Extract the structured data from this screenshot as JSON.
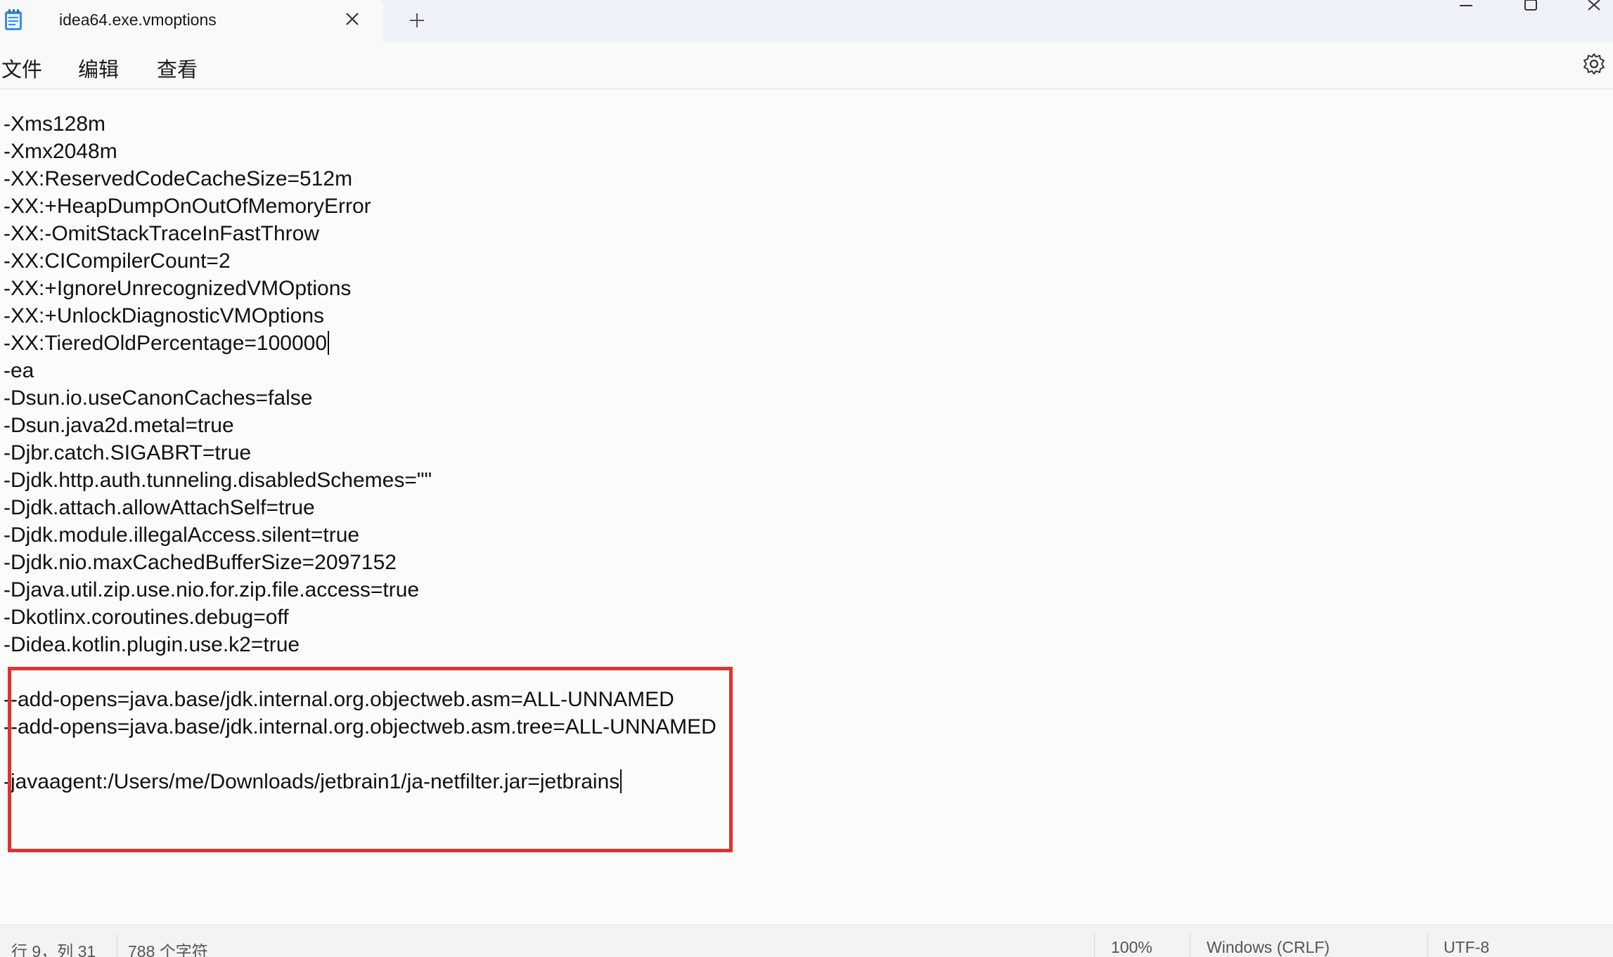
{
  "window": {
    "tab_title": "idea64.exe.vmoptions",
    "icons": {
      "app": "notepad-icon",
      "tab_close": "close-icon",
      "new_tab": "plus-icon",
      "minimize": "minimize-icon",
      "maximize": "maximize-icon",
      "close": "close-icon",
      "settings": "gear-icon"
    }
  },
  "menu": {
    "file": "文件",
    "edit": "编辑",
    "view": "查看"
  },
  "editor": {
    "lines": [
      "-Xms128m",
      "-Xmx2048m",
      "-XX:ReservedCodeCacheSize=512m",
      "-XX:+HeapDumpOnOutOfMemoryError",
      "-XX:-OmitStackTraceInFastThrow",
      "-XX:CICompilerCount=2",
      "-XX:+IgnoreUnrecognizedVMOptions",
      "-XX:+UnlockDiagnosticVMOptions",
      "-XX:TieredOldPercentage=100000",
      "-ea",
      "-Dsun.io.useCanonCaches=false",
      "-Dsun.java2d.metal=true",
      "-Djbr.catch.SIGABRT=true",
      "-Djdk.http.auth.tunneling.disabledSchemes=\"\"",
      "-Djdk.attach.allowAttachSelf=true",
      "-Djdk.module.illegalAccess.silent=true",
      "-Djdk.nio.maxCachedBufferSize=2097152",
      "-Djava.util.zip.use.nio.for.zip.file.access=true",
      "-Dkotlinx.coroutines.debug=off",
      "-Didea.kotlin.plugin.use.k2=true",
      "",
      "--add-opens=java.base/jdk.internal.org.objectweb.asm=ALL-UNNAMED",
      "--add-opens=java.base/jdk.internal.org.objectweb.asm.tree=ALL-UNNAMED",
      "",
      "-javaagent:/Users/me/Downloads/jetbrain1/ja-netfilter.jar=jetbrains"
    ],
    "highlight_color": "#e0332f"
  },
  "status": {
    "position": "行 9，列 31",
    "char_count": "788 个字符",
    "zoom": "100%",
    "line_ending": "Windows (CRLF)",
    "encoding": "UTF-8"
  }
}
